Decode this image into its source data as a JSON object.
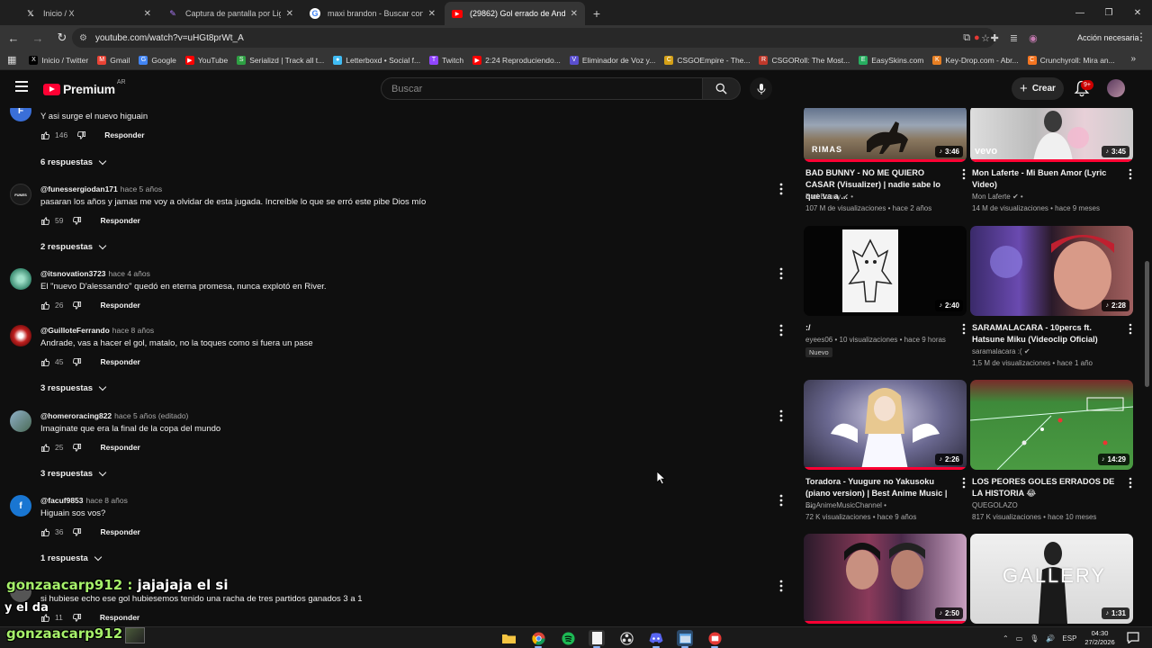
{
  "browser": {
    "tabs": [
      {
        "title": "Inicio / X",
        "icon": "x-logo-icon",
        "active": false
      },
      {
        "title": "Captura de pantalla por Lightshot",
        "icon": "lightshot-icon",
        "active": false
      },
      {
        "title": "maxi brandon - Buscar con Google",
        "icon": "google-icon",
        "active": false
      },
      {
        "title": "(29862) Gol errado de Andrade",
        "icon": "youtube-icon",
        "active": true
      }
    ],
    "url": "youtube.com/watch?v=uHGt8prWt_A",
    "profile_label": "Acción necesaria",
    "bookmarks": [
      {
        "label": "Inicio / Twitter",
        "color": "#000000",
        "glyph": "X"
      },
      {
        "label": "Gmail",
        "color": "#ea4335",
        "glyph": "M"
      },
      {
        "label": "Google",
        "color": "#4285f4",
        "glyph": "G"
      },
      {
        "label": "YouTube",
        "color": "#ff0000",
        "glyph": "▶"
      },
      {
        "label": "Serializd | Track all t...",
        "color": "#2ea043",
        "glyph": "S"
      },
      {
        "label": "Letterboxd • Social f...",
        "color": "#40bcf4",
        "glyph": "●"
      },
      {
        "label": "Twitch",
        "color": "#9146ff",
        "glyph": "T"
      },
      {
        "label": "2:24 Reproduciendo...",
        "color": "#ff0000",
        "glyph": "▶"
      },
      {
        "label": "Eliminador de Voz y...",
        "color": "#5a4fcf",
        "glyph": "V"
      },
      {
        "label": "CSGOEmpire - The...",
        "color": "#d4a017",
        "glyph": "C"
      },
      {
        "label": "CSGORoll: The Most...",
        "color": "#c0392b",
        "glyph": "R"
      },
      {
        "label": "EasySkins.com",
        "color": "#27ae60",
        "glyph": "E"
      },
      {
        "label": "Key-Drop.com - Abr...",
        "color": "#e67e22",
        "glyph": "K"
      },
      {
        "label": "Crunchyroll: Mira an...",
        "color": "#f47521",
        "glyph": "C"
      }
    ]
  },
  "youtube": {
    "logo_text": "Premium",
    "region": "AR",
    "search_placeholder": "Buscar",
    "create_label": "Crear",
    "notifications_badge": "9+"
  },
  "comments": [
    {
      "handle": "",
      "time": "",
      "text": "Y asi surge el nuevo higuain",
      "likes": "146",
      "reply_label": "Responder",
      "replies": "6 respuestas",
      "avatar_letter": "F",
      "avatar_color": "#3a6fd8"
    },
    {
      "handle": "@funessergiodan171",
      "time": "hace 5 años",
      "text": "pasaran los años y jamas me voy a olvidar de esta jugada. Increíble lo que se erró este pibe Dios mío",
      "likes": "59",
      "reply_label": "Responder",
      "replies": "2 respuestas",
      "avatar_letter": "FUNES",
      "avatar_color": "#1b1b1b"
    },
    {
      "handle": "@itsnovation3723",
      "time": "hace 4 años",
      "text": "El \"nuevo D'alessandro\" quedó en eterna promesa, nunca explotó en River.",
      "likes": "26",
      "reply_label": "Responder",
      "replies": "",
      "avatar_letter": "",
      "avatar_color": "#4aa88a"
    },
    {
      "handle": "@GuilloteFerrando",
      "time": "hace 8 años",
      "text": "Andrade, vas a hacer el gol, matalo, no la toques como si fuera un pase",
      "likes": "45",
      "reply_label": "Responder",
      "replies": "3 respuestas",
      "avatar_letter": "",
      "avatar_color": "#c0201f"
    },
    {
      "handle": "@homeroracing822",
      "time": "hace 5 años (editado)",
      "text": "Imaginate que era la final de la copa del mundo",
      "likes": "25",
      "reply_label": "Responder",
      "replies": "3 respuestas",
      "avatar_letter": "",
      "avatar_color": "#7a9ab8"
    },
    {
      "handle": "@facuf9853",
      "time": "hace 8 años",
      "text": "Higuain sos vos?",
      "likes": "36",
      "reply_label": "Responder",
      "replies": "1 respuesta",
      "avatar_letter": "f",
      "avatar_color": "#1976d2"
    },
    {
      "handle": "",
      "time": "",
      "text": "si hubiese echo ese gol hubiesemos tenido una racha de tres partidos ganados 3 a 1",
      "likes": "11",
      "reply_label": "Responder",
      "replies": "",
      "avatar_letter": "",
      "avatar_color": "#555555"
    }
  ],
  "related": [
    {
      "title": "BAD BUNNY - NO ME QUIERO CASAR (Visualizer) | nadie sabe lo que va a ...",
      "channel": "Bad Bunny",
      "verified": true,
      "stats": "107 M de visualizaciones • hace 2 años",
      "duration": "3:46",
      "watched": 1.0,
      "thumb_label": "RIMAS",
      "nuevo": ""
    },
    {
      "title": "Mon Laferte - Mi Buen Amor (Lyric Video)",
      "channel": "Mon Laferte",
      "verified": true,
      "stats": "14 M de visualizaciones • hace 9 meses",
      "duration": "3:45",
      "watched": 1.0,
      "thumb_label": "vevo",
      "nuevo": ""
    },
    {
      "title": ":/",
      "channel": "eyees06",
      "verified": false,
      "stats": "10 visualizaciones • hace 9 horas",
      "duration": "2:40",
      "watched": 0,
      "thumb_label": "",
      "nuevo": "Nuevo"
    },
    {
      "title": "SARAMALACARA - 10percs ft. Hatsune Miku (Videoclip Oficial)",
      "channel": "saramalacara :(",
      "verified": true,
      "stats": "1,5 M de visualizaciones • hace 1 año",
      "duration": "2:28",
      "watched": 0,
      "thumb_label": "",
      "nuevo": ""
    },
    {
      "title": "Toradora - Yuugure no Yakusoku (piano version) | Best Anime Music | ...",
      "channel": "BigAnimeMusicChannel",
      "verified": false,
      "stats": "72 K visualizaciones • hace 9 años",
      "duration": "2:26",
      "watched": 1.0,
      "thumb_label": "",
      "nuevo": ""
    },
    {
      "title": "LOS PEORES GOLES ERRADOS DE LA HISTORIA 😂",
      "channel": "QUEGOLAZO",
      "verified": false,
      "stats": "817 K visualizaciones • hace 10 meses",
      "duration": "14:29",
      "watched": 0,
      "thumb_label": "",
      "nuevo": ""
    },
    {
      "title": "",
      "channel": "",
      "verified": false,
      "stats": "",
      "duration": "2:50",
      "watched": 1.0,
      "thumb_label": "",
      "nuevo": ""
    },
    {
      "title": "",
      "channel": "",
      "verified": false,
      "stats": "",
      "duration": "1:31",
      "watched": 0,
      "thumb_label": "GALLERY",
      "nuevo": ""
    }
  ],
  "overlay": {
    "line1_user": "gonzaacarp912 :",
    "line1_msg": " jajajaja el si",
    "line2": "y el da",
    "line3_user": "gonzaacarp912 :"
  },
  "taskbar": {
    "lang": "ESP",
    "time": "04:30",
    "date": "27/2/2026"
  }
}
